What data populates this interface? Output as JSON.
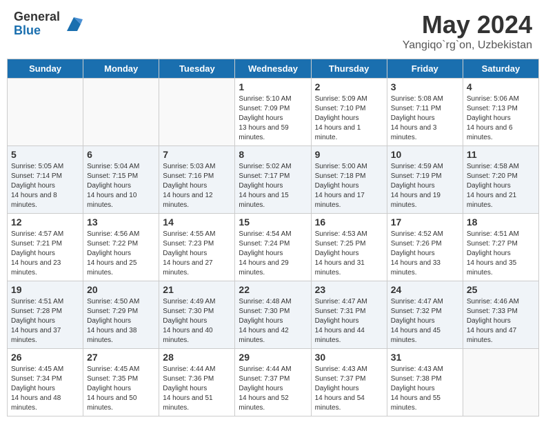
{
  "header": {
    "logo_general": "General",
    "logo_blue": "Blue",
    "month_title": "May 2024",
    "location": "Yangiqo`rg`on, Uzbekistan"
  },
  "days_of_week": [
    "Sunday",
    "Monday",
    "Tuesday",
    "Wednesday",
    "Thursday",
    "Friday",
    "Saturday"
  ],
  "weeks": [
    [
      {
        "day": "",
        "empty": true
      },
      {
        "day": "",
        "empty": true
      },
      {
        "day": "",
        "empty": true
      },
      {
        "day": "1",
        "sunrise": "5:10 AM",
        "sunset": "7:09 PM",
        "daylight": "13 hours and 59 minutes."
      },
      {
        "day": "2",
        "sunrise": "5:09 AM",
        "sunset": "7:10 PM",
        "daylight": "14 hours and 1 minute."
      },
      {
        "day": "3",
        "sunrise": "5:08 AM",
        "sunset": "7:11 PM",
        "daylight": "14 hours and 3 minutes."
      },
      {
        "day": "4",
        "sunrise": "5:06 AM",
        "sunset": "7:13 PM",
        "daylight": "14 hours and 6 minutes."
      }
    ],
    [
      {
        "day": "5",
        "sunrise": "5:05 AM",
        "sunset": "7:14 PM",
        "daylight": "14 hours and 8 minutes."
      },
      {
        "day": "6",
        "sunrise": "5:04 AM",
        "sunset": "7:15 PM",
        "daylight": "14 hours and 10 minutes."
      },
      {
        "day": "7",
        "sunrise": "5:03 AM",
        "sunset": "7:16 PM",
        "daylight": "14 hours and 12 minutes."
      },
      {
        "day": "8",
        "sunrise": "5:02 AM",
        "sunset": "7:17 PM",
        "daylight": "14 hours and 15 minutes."
      },
      {
        "day": "9",
        "sunrise": "5:00 AM",
        "sunset": "7:18 PM",
        "daylight": "14 hours and 17 minutes."
      },
      {
        "day": "10",
        "sunrise": "4:59 AM",
        "sunset": "7:19 PM",
        "daylight": "14 hours and 19 minutes."
      },
      {
        "day": "11",
        "sunrise": "4:58 AM",
        "sunset": "7:20 PM",
        "daylight": "14 hours and 21 minutes."
      }
    ],
    [
      {
        "day": "12",
        "sunrise": "4:57 AM",
        "sunset": "7:21 PM",
        "daylight": "14 hours and 23 minutes."
      },
      {
        "day": "13",
        "sunrise": "4:56 AM",
        "sunset": "7:22 PM",
        "daylight": "14 hours and 25 minutes."
      },
      {
        "day": "14",
        "sunrise": "4:55 AM",
        "sunset": "7:23 PM",
        "daylight": "14 hours and 27 minutes."
      },
      {
        "day": "15",
        "sunrise": "4:54 AM",
        "sunset": "7:24 PM",
        "daylight": "14 hours and 29 minutes."
      },
      {
        "day": "16",
        "sunrise": "4:53 AM",
        "sunset": "7:25 PM",
        "daylight": "14 hours and 31 minutes."
      },
      {
        "day": "17",
        "sunrise": "4:52 AM",
        "sunset": "7:26 PM",
        "daylight": "14 hours and 33 minutes."
      },
      {
        "day": "18",
        "sunrise": "4:51 AM",
        "sunset": "7:27 PM",
        "daylight": "14 hours and 35 minutes."
      }
    ],
    [
      {
        "day": "19",
        "sunrise": "4:51 AM",
        "sunset": "7:28 PM",
        "daylight": "14 hours and 37 minutes."
      },
      {
        "day": "20",
        "sunrise": "4:50 AM",
        "sunset": "7:29 PM",
        "daylight": "14 hours and 38 minutes."
      },
      {
        "day": "21",
        "sunrise": "4:49 AM",
        "sunset": "7:30 PM",
        "daylight": "14 hours and 40 minutes."
      },
      {
        "day": "22",
        "sunrise": "4:48 AM",
        "sunset": "7:30 PM",
        "daylight": "14 hours and 42 minutes."
      },
      {
        "day": "23",
        "sunrise": "4:47 AM",
        "sunset": "7:31 PM",
        "daylight": "14 hours and 44 minutes."
      },
      {
        "day": "24",
        "sunrise": "4:47 AM",
        "sunset": "7:32 PM",
        "daylight": "14 hours and 45 minutes."
      },
      {
        "day": "25",
        "sunrise": "4:46 AM",
        "sunset": "7:33 PM",
        "daylight": "14 hours and 47 minutes."
      }
    ],
    [
      {
        "day": "26",
        "sunrise": "4:45 AM",
        "sunset": "7:34 PM",
        "daylight": "14 hours and 48 minutes."
      },
      {
        "day": "27",
        "sunrise": "4:45 AM",
        "sunset": "7:35 PM",
        "daylight": "14 hours and 50 minutes."
      },
      {
        "day": "28",
        "sunrise": "4:44 AM",
        "sunset": "7:36 PM",
        "daylight": "14 hours and 51 minutes."
      },
      {
        "day": "29",
        "sunrise": "4:44 AM",
        "sunset": "7:37 PM",
        "daylight": "14 hours and 52 minutes."
      },
      {
        "day": "30",
        "sunrise": "4:43 AM",
        "sunset": "7:37 PM",
        "daylight": "14 hours and 54 minutes."
      },
      {
        "day": "31",
        "sunrise": "4:43 AM",
        "sunset": "7:38 PM",
        "daylight": "14 hours and 55 minutes."
      },
      {
        "day": "",
        "empty": true
      }
    ]
  ],
  "labels": {
    "sunrise": "Sunrise:",
    "sunset": "Sunset:",
    "daylight": "Daylight hours"
  }
}
